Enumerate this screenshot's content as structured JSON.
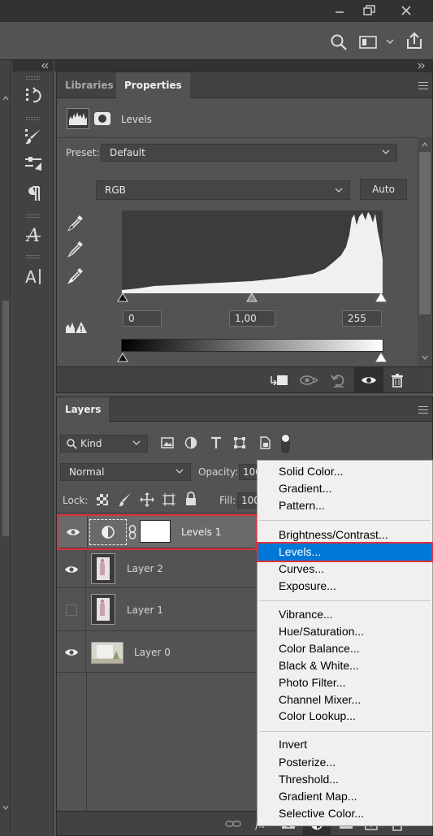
{
  "properties_panel": {
    "tabs": [
      {
        "label": "Libraries",
        "active": false
      },
      {
        "label": "Properties",
        "active": true
      }
    ],
    "adjustment_title": "Levels",
    "preset_label": "Preset:",
    "preset_value": "Default",
    "channel_value": "RGB",
    "auto_button": "Auto",
    "input_black": "0",
    "input_gamma": "1,00",
    "input_white": "255"
  },
  "layers_panel": {
    "tab_label": "Layers",
    "filter_kind": "Kind",
    "blend_mode": "Normal",
    "opacity_label": "Opacity:",
    "opacity_value": "100",
    "fill_label": "Fill:",
    "fill_value": "100",
    "lock_label": "Lock:",
    "layers": [
      {
        "name": "Levels 1",
        "visible": true,
        "selected": true
      },
      {
        "name": "Layer 2",
        "visible": true,
        "selected": false
      },
      {
        "name": "Layer 1",
        "visible": false,
        "selected": false
      },
      {
        "name": "Layer 0",
        "visible": true,
        "selected": false
      }
    ]
  },
  "context_menu": {
    "groups": [
      [
        "Solid Color...",
        "Gradient...",
        "Pattern..."
      ],
      [
        "Brightness/Contrast...",
        "Levels...",
        "Curves...",
        "Exposure..."
      ],
      [
        "Vibrance...",
        "Hue/Saturation...",
        "Color Balance...",
        "Black & White...",
        "Photo Filter...",
        "Channel Mixer...",
        "Color Lookup..."
      ],
      [
        "Invert",
        "Posterize...",
        "Threshold...",
        "Gradient Map...",
        "Selective Color..."
      ]
    ],
    "highlighted": "Levels..."
  },
  "colors": {
    "panel_bg": "#535353",
    "dark_bg": "#424242",
    "menu_bg": "#f0f0f0",
    "highlight": "#0078d7",
    "annotation_red": "#e0303a"
  }
}
